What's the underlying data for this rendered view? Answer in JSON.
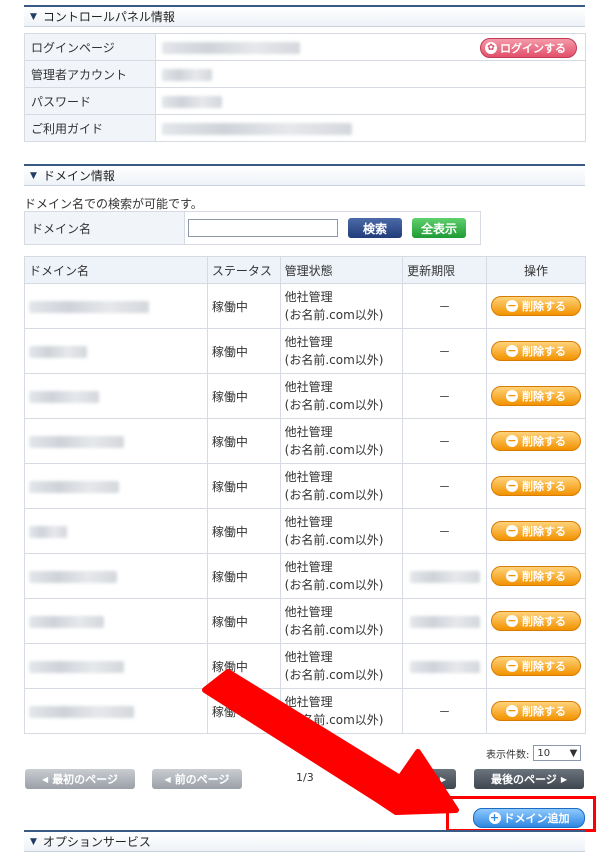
{
  "control_panel": {
    "title": "コントロールパネル情報",
    "rows": [
      {
        "label": "ログインページ"
      },
      {
        "label": "管理者アカウント"
      },
      {
        "label": "パスワード"
      },
      {
        "label": "ご利用ガイド"
      }
    ],
    "login_button": "ログインする"
  },
  "domain_info": {
    "title": "ドメイン情報",
    "search_note": "ドメイン名での検索が可能です。",
    "search_label": "ドメイン名",
    "search_value": "",
    "search_button": "検索",
    "show_all_button": "全表示"
  },
  "domain_table": {
    "headers": [
      "ドメイン名",
      "ステータス",
      "管理状態",
      "更新期限",
      "操作"
    ],
    "rows": [
      {
        "status": "稼働中",
        "mgmt1": "他社管理",
        "mgmt2": "(お名前.com以外)",
        "expiry": "－",
        "action": "削除する"
      },
      {
        "status": "稼働中",
        "mgmt1": "他社管理",
        "mgmt2": "(お名前.com以外)",
        "expiry": "－",
        "action": "削除する"
      },
      {
        "status": "稼働中",
        "mgmt1": "他社管理",
        "mgmt2": "(お名前.com以外)",
        "expiry": "－",
        "action": "削除する"
      },
      {
        "status": "稼働中",
        "mgmt1": "他社管理",
        "mgmt2": "(お名前.com以外)",
        "expiry": "－",
        "action": "削除する"
      },
      {
        "status": "稼働中",
        "mgmt1": "他社管理",
        "mgmt2": "(お名前.com以外)",
        "expiry": "－",
        "action": "削除する"
      },
      {
        "status": "稼働中",
        "mgmt1": "他社管理",
        "mgmt2": "(お名前.com以外)",
        "expiry": "－",
        "action": "削除する"
      },
      {
        "status": "稼働中",
        "mgmt1": "他社管理",
        "mgmt2": "(お名前.com以外)",
        "expiry": "",
        "action": "削除する"
      },
      {
        "status": "稼働中",
        "mgmt1": "他社管理",
        "mgmt2": "(お名前.com以外)",
        "expiry": "",
        "action": "削除する"
      },
      {
        "status": "稼働中",
        "mgmt1": "他社管理",
        "mgmt2": "(お名前.com以外)",
        "expiry": "",
        "action": "削除する"
      },
      {
        "status": "稼働中",
        "mgmt1": "他社管理",
        "mgmt2": "(お名前.com以外)",
        "expiry": "－",
        "action": "削除する"
      }
    ]
  },
  "pagination": {
    "per_page_label": "表示件数:",
    "per_page_value": "10",
    "first": "最初のページ",
    "prev": "前のページ",
    "page_info": "1/3",
    "last": "最後のページ"
  },
  "add_domain_button": "ドメイン追加",
  "option_section_title": "オプションサービス",
  "colors": {
    "header_border": "#3a5a86",
    "delete_button": "#f29200",
    "login_button": "#e2506a",
    "add_button": "#2e86e0",
    "highlight": "#ff0000"
  }
}
